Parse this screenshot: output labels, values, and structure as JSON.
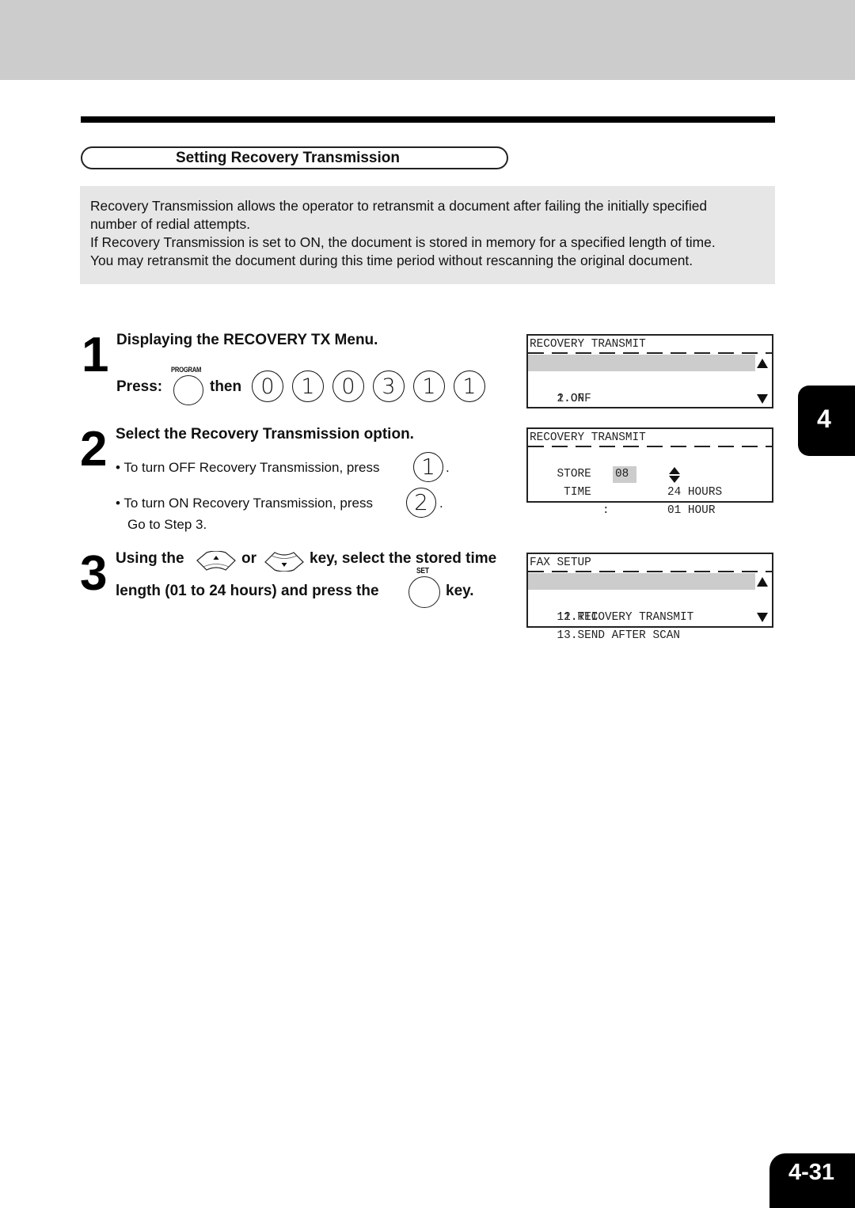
{
  "section": {
    "title": "Setting Recovery Transmission",
    "intro": [
      "Recovery Transmission allows the operator to retransmit a document after  failing the initially specified",
      "number of redial attempts.",
      "If Recovery Transmission is set to ON, the document is stored in memory for a specified length of time.",
      "You may retransmit the document during this time period without rescanning the original document."
    ]
  },
  "steps": [
    {
      "number": "1",
      "heading": "Displaying the RECOVERY TX Menu.",
      "press_label": "Press:",
      "program_key_caption": "PROGRAM",
      "then_label": "then",
      "keys": [
        "0",
        "1",
        "0",
        "3",
        "1",
        "1"
      ]
    },
    {
      "number": "2",
      "heading": "Select the Recovery Transmission option.",
      "bullets": [
        {
          "text": "• To turn OFF Recovery Transmission, press",
          "key": "1",
          "suffix": "."
        },
        {
          "text": "• To turn ON Recovery Transmission, press",
          "key": "2",
          "suffix": "."
        }
      ],
      "followup": "Go to Step 3."
    },
    {
      "number": "3",
      "line1_a": "Using the",
      "line1_b": "or",
      "line1_c": "key, select the stored time",
      "line2_a": "length (01 to 24 hours) and press the",
      "set_key_caption": "SET",
      "line2_b": "key."
    }
  ],
  "icons": {
    "up_key": "up-arrow-key-icon",
    "down_key": "down-arrow-key-icon"
  },
  "lcd_screens": [
    {
      "title": "RECOVERY TRANSMIT",
      "rows": [
        "1.OFF",
        "2.ON",
        ""
      ],
      "selected_row": 0
    },
    {
      "title": "RECOVERY TRANSMIT",
      "store_label": "STORE",
      "max_value": "24 HOURS",
      "time_label": " TIME",
      "colon": ":",
      "time_value": "08",
      "min_value": "01 HOUR"
    },
    {
      "title": "FAX SETUP",
      "rows": [
        "11.RECOVERY TRANSMIT",
        "12.TTI",
        "13.SEND AFTER SCAN"
      ],
      "selected_row": 0
    }
  ],
  "chapter_tab": "4",
  "page_number": "4-31",
  "colors": {
    "header_band": "#cccccc",
    "intro_bg": "#e6e6e6",
    "lcd_highlight": "#cccccc"
  }
}
